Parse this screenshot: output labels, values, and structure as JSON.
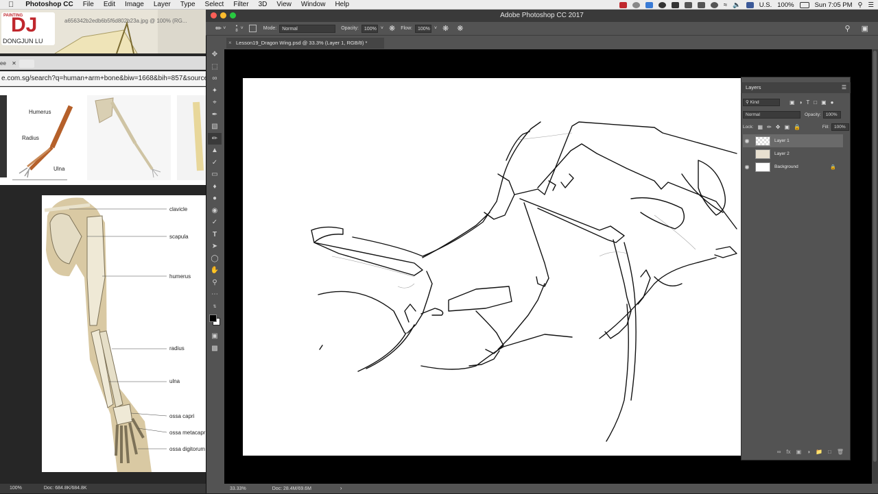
{
  "menubar": {
    "app": "Photoshop CC",
    "items": [
      "File",
      "Edit",
      "Image",
      "Layer",
      "Type",
      "Select",
      "Filter",
      "3D",
      "View",
      "Window",
      "Help"
    ],
    "locale": "U.S.",
    "battery": "100%",
    "clock": "Sun 7:05 PM"
  },
  "browser": {
    "logo_small": "PAINTING",
    "logo_big": "DJ",
    "logo_name": "DONGJUN LU",
    "filename": "a656342b2edb6b5f6d802b23a.jpg @ 100% (RG...",
    "tab": "ee",
    "url": "e.com.sg/search?q=human+arm+bone&biw=1668&bih=857&source=",
    "thumb_labels": [
      "Humerus",
      "Radius",
      "Ulna"
    ]
  },
  "arm_diagram": {
    "labels": [
      "clavicle",
      "scapula",
      "humerus",
      "radius",
      "ulna",
      "ossa capri",
      "ossa metacapri",
      "ossa digitorum"
    ]
  },
  "left_status": {
    "zoom": "100%",
    "doc": "Doc: 684.8K/684.8K"
  },
  "photoshop": {
    "window_title": "Adobe Photoshop CC 2017",
    "brush_size": "8",
    "mode_label": "Mode:",
    "mode_value": "Normal",
    "opacity_label": "Opacity:",
    "opacity_value": "100%",
    "flow_label": "Flow:",
    "flow_value": "100%",
    "doc_tab": "Lesson19_Dragon Wing.psd @ 33.3% (Layer 1, RGB/8) *",
    "status_zoom": "33.33%",
    "status_doc": "Doc: 28.4M/69.6M"
  },
  "layers_panel": {
    "title": "Layers",
    "kind": "Kind",
    "blend": "Normal",
    "opacity_label": "Opacity:",
    "opacity_value": "100%",
    "lock_label": "Lock:",
    "fill_label": "Fill:",
    "fill_value": "100%",
    "layers": [
      {
        "name": "Layer 1",
        "visible": true,
        "active": true
      },
      {
        "name": "Layer 2",
        "visible": false,
        "active": false
      },
      {
        "name": "Background",
        "visible": true,
        "active": false
      }
    ]
  },
  "colors": {
    "ps_bg": "#535353",
    "canvas_bg": "#000000",
    "accent": "#0a84ff"
  }
}
